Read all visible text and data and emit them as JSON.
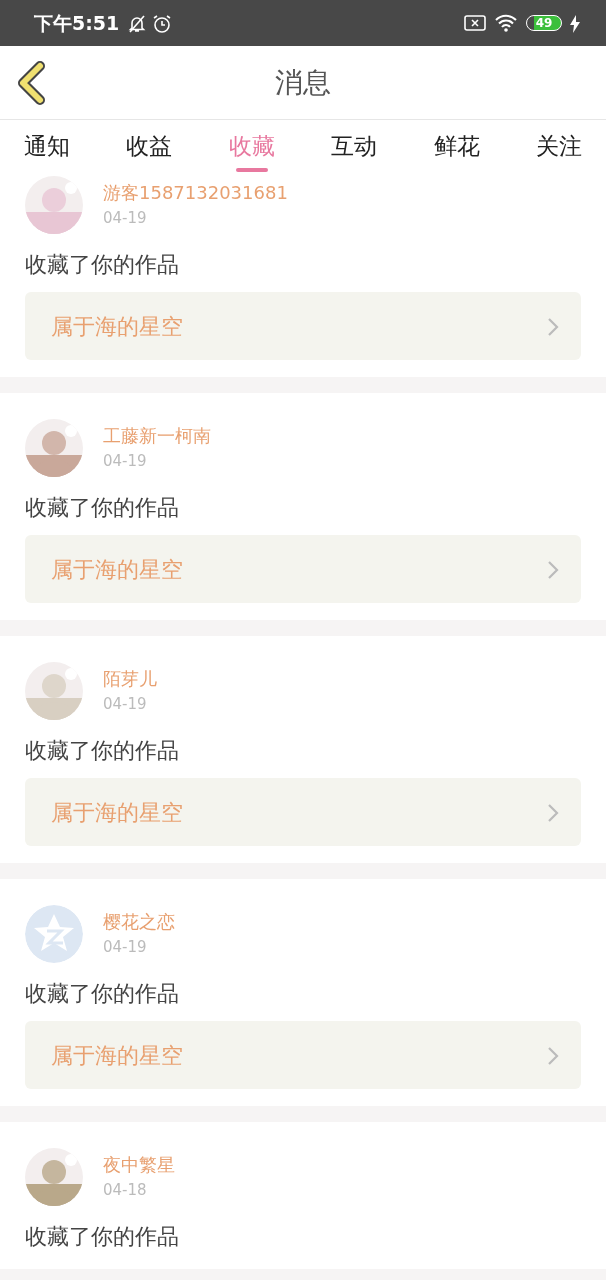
{
  "status_bar": {
    "time": "下午5:51",
    "battery": "49"
  },
  "header": {
    "title": "消息"
  },
  "tabs": [
    {
      "label": "通知",
      "selected": false
    },
    {
      "label": "收益",
      "selected": false
    },
    {
      "label": "收藏",
      "selected": true
    },
    {
      "label": "互动",
      "selected": false
    },
    {
      "label": "鲜花",
      "selected": false
    },
    {
      "label": "关注",
      "selected": false
    }
  ],
  "messages": [
    {
      "user": "游客1587132031681",
      "date": "04-19",
      "text": "收藏了你的作品",
      "work": "属于海的星空"
    },
    {
      "user": "工藤新一柯南",
      "date": "04-19",
      "text": "收藏了你的作品",
      "work": "属于海的星空"
    },
    {
      "user": "陌芽儿",
      "date": "04-19",
      "text": "收藏了你的作品",
      "work": "属于海的星空"
    },
    {
      "avatar": {
        "kind": "default"
      },
      "user": "樱花之恋",
      "date": "04-19",
      "text": "收藏了你的作品",
      "work": "属于海的星空"
    },
    {
      "user": "夜中繁星",
      "date": "04-18",
      "text": "收藏了你的作品"
    }
  ]
}
